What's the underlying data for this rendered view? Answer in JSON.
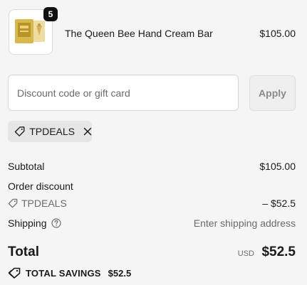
{
  "cart": {
    "item": {
      "quantity": "5",
      "name": "The Queen Bee Hand Cream Bar",
      "price": "$105.00"
    }
  },
  "discount": {
    "placeholder": "Discount code or gift card",
    "apply_label": "Apply",
    "applied_code": "TPDEALS"
  },
  "summary": {
    "subtotal_label": "Subtotal",
    "subtotal_value": "$105.00",
    "order_discount_label": "Order discount",
    "discount_code": "TPDEALS",
    "discount_value": "– $52.5",
    "shipping_label": "Shipping",
    "shipping_value": "Enter shipping address",
    "total_label": "Total",
    "currency": "USD",
    "total_value": "$52.5",
    "savings_label": "TOTAL SAVINGS",
    "savings_value": "$52.5"
  },
  "icons": {
    "tag": "tag-icon",
    "close": "close-icon",
    "help": "help-circle-icon",
    "savings": "savings-tag-icon"
  }
}
